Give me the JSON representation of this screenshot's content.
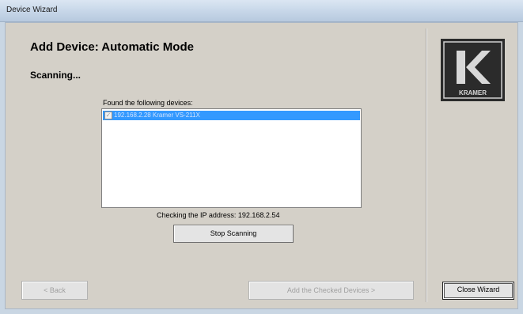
{
  "window": {
    "title": "Device Wizard"
  },
  "main": {
    "heading": "Add Device: Automatic Mode",
    "status": "Scanning...",
    "found_label": "Found the following devices:",
    "devices": [
      {
        "label": "192.168.2.28 Kramer VS-211X",
        "checked": true,
        "selected": true
      }
    ],
    "checking_text": "Checking the IP address:  192.168.2.54"
  },
  "buttons": {
    "stop": "Stop Scanning",
    "back": "< Back",
    "add": "Add the Checked Devices >",
    "close": "Close Wizard"
  },
  "logo": {
    "text": "KRAMER"
  }
}
